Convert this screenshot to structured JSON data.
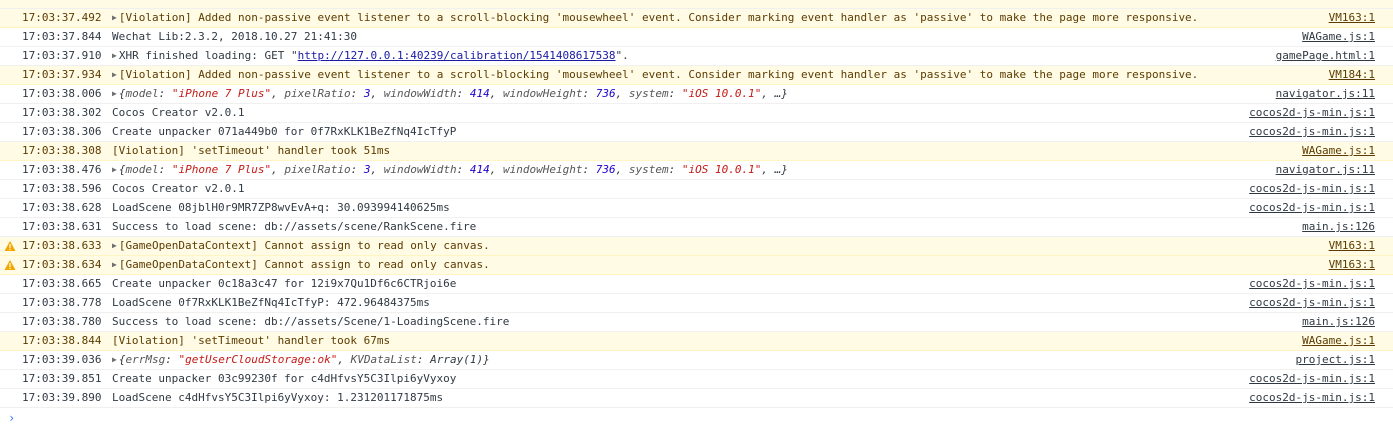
{
  "console": {
    "rows": [
      {
        "level": "violation",
        "time": "17:03:37.492",
        "message": "[Violation] Added non-passive event listener to a scroll-blocking 'mousewheel' event. Consider marking event handler as 'passive' to make the page more responsive.",
        "source": "VM163:1"
      },
      {
        "level": "log",
        "time": "17:03:37.844",
        "message": "Wechat Lib:2.3.2, 2018.10.27 21:41:30",
        "source": "WAGame.js:1"
      },
      {
        "level": "log",
        "time": "17:03:37.910",
        "prefix": "XHR finished loading: GET \"",
        "url": "http://127.0.0.1:40239/calibration/1541408617538",
        "suffix": "\".",
        "source": "gamePage.html:1"
      },
      {
        "level": "violation",
        "time": "17:03:37.934",
        "message": "[Violation] Added non-passive event listener to a scroll-blocking 'mousewheel' event. Consider marking event handler as 'passive' to make the page more responsive.",
        "source": "VM184:1"
      },
      {
        "level": "log",
        "time": "17:03:38.006",
        "object": {
          "k1": "model",
          "v1": "\"iPhone 7 Plus\"",
          "k2": "pixelRatio",
          "v2": "3",
          "k3": "windowWidth",
          "v3": "414",
          "k4": "windowHeight",
          "v4": "736",
          "k5": "system",
          "v5": "\"iOS 10.0.1\"",
          "tail": "…"
        },
        "source": "navigator.js:11"
      },
      {
        "level": "log",
        "time": "17:03:38.302",
        "message": "Cocos Creator v2.0.1",
        "source": "cocos2d-js-min.js:1"
      },
      {
        "level": "log",
        "time": "17:03:38.306",
        "message": "Create unpacker 071a449b0 for 0f7RxKLK1BeZfNq4IcTfyP",
        "source": "cocos2d-js-min.js:1"
      },
      {
        "level": "violation",
        "time": "17:03:38.308",
        "message": "[Violation] 'setTimeout' handler took 51ms",
        "source": "WAGame.js:1"
      },
      {
        "level": "log",
        "time": "17:03:38.476",
        "object": {
          "k1": "model",
          "v1": "\"iPhone 7 Plus\"",
          "k2": "pixelRatio",
          "v2": "3",
          "k3": "windowWidth",
          "v3": "414",
          "k4": "windowHeight",
          "v4": "736",
          "k5": "system",
          "v5": "\"iOS 10.0.1\"",
          "tail": "…"
        },
        "source": "navigator.js:11"
      },
      {
        "level": "log",
        "time": "17:03:38.596",
        "message": "Cocos Creator v2.0.1",
        "source": "cocos2d-js-min.js:1"
      },
      {
        "level": "log",
        "time": "17:03:38.628",
        "message": "LoadScene 08jblH0r9MR7ZP8wvEvA+q: 30.093994140625ms",
        "source": "cocos2d-js-min.js:1"
      },
      {
        "level": "log",
        "time": "17:03:38.631",
        "message": "Success to load scene: db://assets/scene/RankScene.fire",
        "source": "main.js:126"
      },
      {
        "level": "warning",
        "time": "17:03:38.633",
        "message": "[GameOpenDataContext] Cannot assign to read only canvas.",
        "source": "VM163:1"
      },
      {
        "level": "warning",
        "time": "17:03:38.634",
        "message": "[GameOpenDataContext] Cannot assign to read only canvas.",
        "source": "VM163:1"
      },
      {
        "level": "log",
        "time": "17:03:38.665",
        "message": "Create unpacker 0c18a3c47 for 12i9x7Qu1Df6c6CTRjoi6e",
        "source": "cocos2d-js-min.js:1"
      },
      {
        "level": "log",
        "time": "17:03:38.778",
        "message": "LoadScene 0f7RxKLK1BeZfNq4IcTfyP: 472.96484375ms",
        "source": "cocos2d-js-min.js:1"
      },
      {
        "level": "log",
        "time": "17:03:38.780",
        "message": "Success to load scene: db://assets/Scene/1-LoadingScene.fire",
        "source": "main.js:126"
      },
      {
        "level": "violation",
        "time": "17:03:38.844",
        "message": "[Violation] 'setTimeout' handler took 67ms",
        "source": "WAGame.js:1"
      },
      {
        "level": "log",
        "time": "17:03:39.036",
        "errobj": {
          "k1": "errMsg",
          "v1": "\"getUserCloudStorage:ok\"",
          "k2": "KVDataList",
          "v2": "Array(1)"
        },
        "source": "project.js:1"
      },
      {
        "level": "log",
        "time": "17:03:39.851",
        "message": "Create unpacker 03c99230f for c4dHfvsY5C3Ilpi6yVyxoy",
        "source": "cocos2d-js-min.js:1"
      },
      {
        "level": "log",
        "time": "17:03:39.890",
        "message": "LoadScene c4dHfvsY5C3Ilpi6yVyxoy: 1.231201171875ms",
        "source": "cocos2d-js-min.js:1"
      }
    ],
    "prompt_symbol": "›"
  },
  "icons": {
    "warning": "warning-triangle-icon",
    "expand": "expand-triangle-icon"
  },
  "colors": {
    "warning_bg": "#fffbe5",
    "warning_text": "#5c3c00",
    "string": "#c41a16",
    "number": "#1c00cf",
    "link": "#1a1aa6",
    "warn_icon": "#f2a600"
  }
}
